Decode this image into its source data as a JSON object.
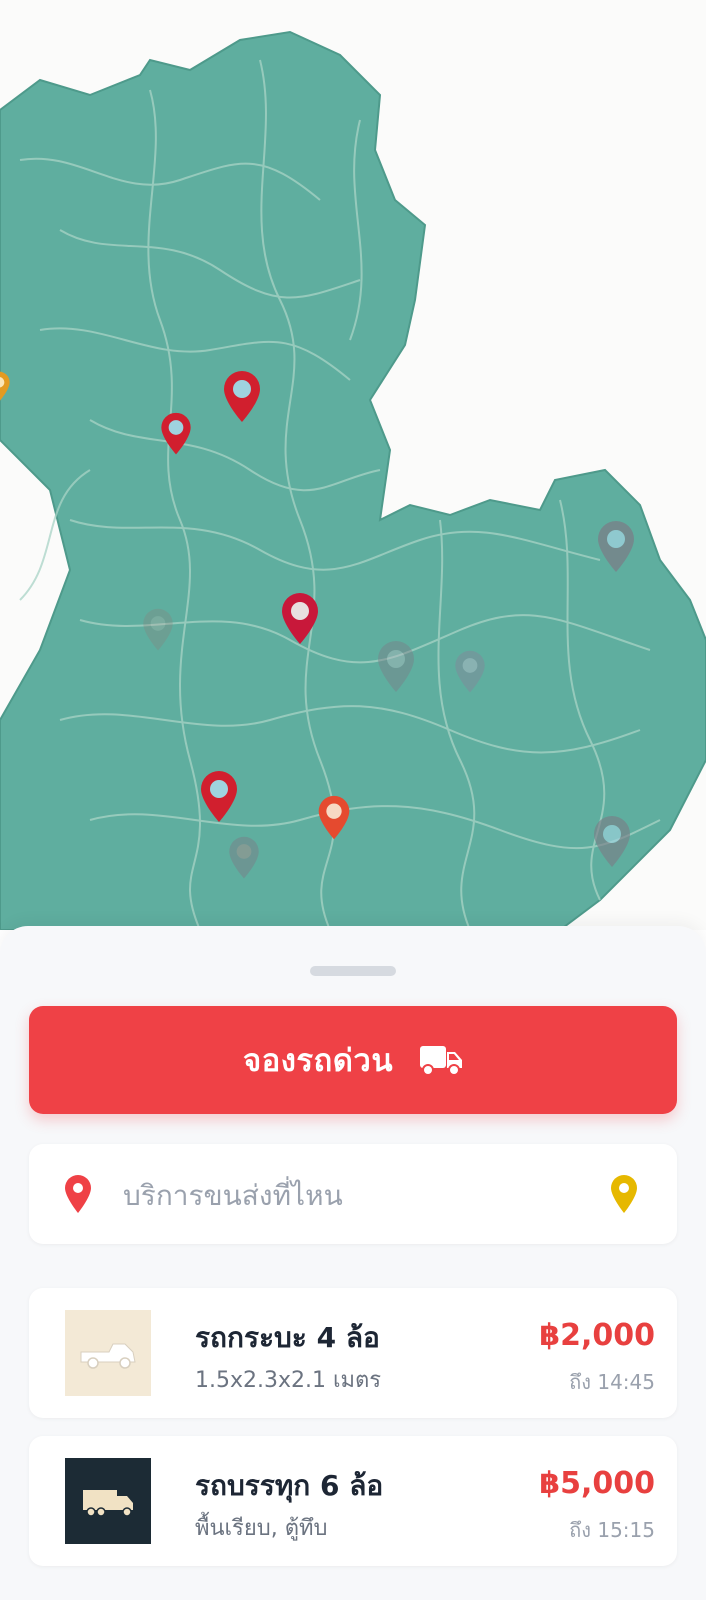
{
  "booking": {
    "label": "จองรถด่วน"
  },
  "search": {
    "placeholder": "บริการขนส่งที่ไหน"
  },
  "vehicles": [
    {
      "name": "รถกระบะ 4 ล้อ",
      "spec": "1.5x2.3x2.1 เมตร",
      "price": "฿2,000",
      "eta": "ถึง 14:45"
    },
    {
      "name": "รถบรรทุก 6 ล้อ",
      "spec": "พื้นเรียบ, ตู้ทึบ",
      "price": "฿5,000",
      "eta": "ถึง 15:15"
    }
  ],
  "colors": {
    "accent": "#ef4146",
    "map_region": "#5fae9f",
    "pin_yellow": "#e6b800",
    "thumb_pickup_bg": "#f3e9d6",
    "thumb_truck_bg": "#1c2b35"
  },
  "icons": [
    "truck-icon",
    "location-pin-icon",
    "map-pin-icon",
    "pickup-truck-icon",
    "cargo-truck-icon"
  ]
}
